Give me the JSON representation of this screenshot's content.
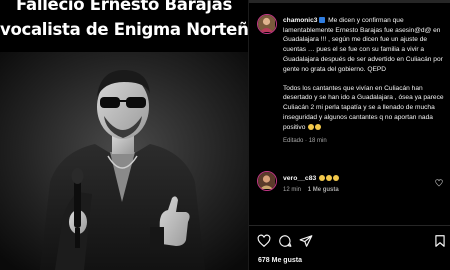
{
  "post_image": {
    "headline_line1": "Fallecio Ernesto Barajas",
    "headline_line2": "vocalista de Enigma Norteño"
  },
  "comments": [
    {
      "username": "chamonic3",
      "paragraph1": "Me dicen y confirman que lamentablemente Ernesto Barajas fue asesin@d@ en Guadalajara !!! , según me dicen fue un ajuste de cuentas … pues el se fue con su familia a vivir a Guadalajara después de ser advertido en Culiacán por gente no grata del gobierno. QEPD",
      "paragraph2": "Todos los cantantes que vivían en Culiacán han desertado y se han ido a Guadalajara , ósea ya parece Culiacán 2 mi perla tapatía y se a llenado de mucha inseguridad y algunos cantantes q no aportan nada positivo",
      "edited_label": "Editado",
      "time": "18 min"
    },
    {
      "username": "vero__c83",
      "time": "12 min",
      "likes": "1 Me gusta"
    }
  ],
  "post_likes": "678 Me gusta",
  "icons": {
    "like": "heart-icon",
    "comment": "comment-bubble-icon",
    "share": "paper-plane-icon",
    "save": "bookmark-icon"
  },
  "colors": {
    "background": "#000000",
    "text": "#f5f5f5",
    "secondary_text": "#a8a8a8",
    "story_ring": "#c13584"
  }
}
